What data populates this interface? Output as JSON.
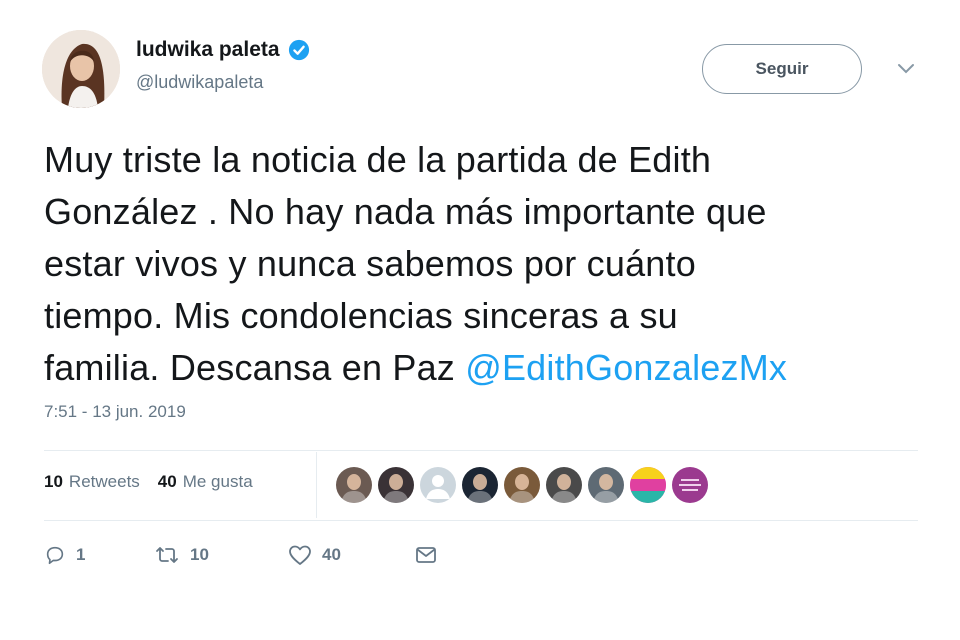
{
  "author": {
    "display_name": "ludwika paleta",
    "handle": "@ludwikapaleta",
    "avatar_icon": "profile-photo"
  },
  "follow_button": {
    "label": "Seguir"
  },
  "tweet": {
    "text_line1": "Muy triste la noticia de la partida de Edith",
    "text_line2": "González . No hay nada más importante que",
    "text_line3": "estar vivos y nunca sabemos por cuánto",
    "text_line4": "tiempo. Mis condolencias sinceras a su",
    "text_line5_prefix": "familia. Descansa en Paz ",
    "mention": "@EdithGonzalezMx",
    "timestamp": "7:51 - 13 jun. 2019"
  },
  "stats": {
    "retweets_count": "10",
    "retweets_label": "Retweets",
    "likes_count": "40",
    "likes_label": "Me gusta"
  },
  "likers": [
    {
      "icon": "user-photo",
      "color": "#6b5a52"
    },
    {
      "icon": "user-photo",
      "color": "#3a3236"
    },
    {
      "icon": "default-avatar",
      "color": "#ccd6dd"
    },
    {
      "icon": "user-photo",
      "color": "#1b2533"
    },
    {
      "icon": "user-photo",
      "color": "#7a5a3a"
    },
    {
      "icon": "user-photo",
      "color": "#4a4a4a"
    },
    {
      "icon": "user-photo",
      "color": "#5e6a74"
    },
    {
      "icon": "colorful-graphic",
      "color": "#e040a0"
    },
    {
      "icon": "text-graphic",
      "color": "#9b3a8f"
    }
  ],
  "actions": {
    "reply_count": "1",
    "retweet_count": "10",
    "like_count": "40"
  },
  "colors": {
    "accent": "#1da1f2",
    "verified": "#1da1f2",
    "secondary_text": "#657786",
    "divider": "#e6ecf0"
  }
}
